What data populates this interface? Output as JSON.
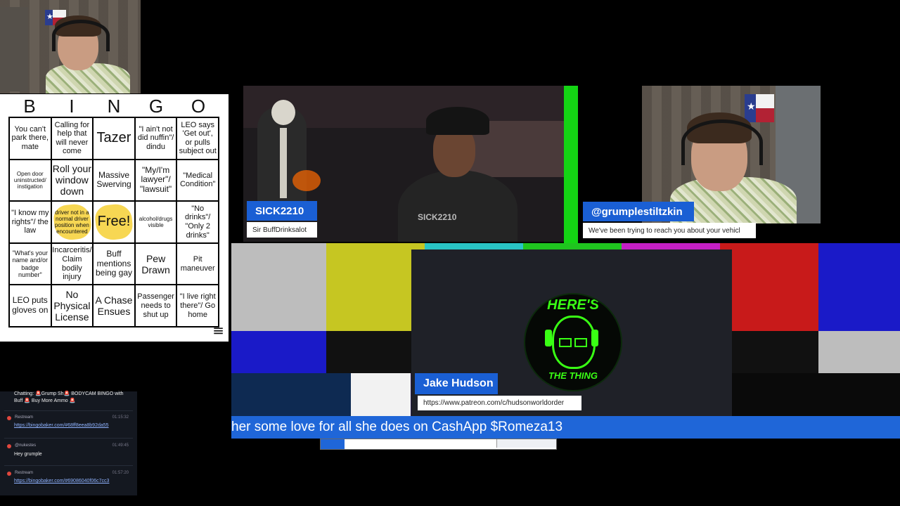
{
  "bingo": {
    "header": [
      "B",
      "I",
      "N",
      "G",
      "O"
    ],
    "cells": [
      {
        "text": "You can't park there, mate",
        "size": "s-s"
      },
      {
        "text": "Calling for help that will never come",
        "size": "s-s"
      },
      {
        "text": "Tazer",
        "size": "s-xl"
      },
      {
        "text": "\"I ain't not did nuffin\"/ dindu",
        "size": "s-s"
      },
      {
        "text": "LEO says 'Get out', or pulls subject out",
        "size": "s-s"
      },
      {
        "text": "Open door uninstructed/ instigation",
        "size": "s-xxs"
      },
      {
        "text": "Roll your window down",
        "size": "s-l"
      },
      {
        "text": "Massive Swerving",
        "size": "s-m"
      },
      {
        "text": "\"My/I'm lawyer\"/ \"lawsuit\"",
        "size": "s-m"
      },
      {
        "text": "\"Medical Condition\"",
        "size": "s-s"
      },
      {
        "text": "\"I know my rights\"/ the law",
        "size": "s-s"
      },
      {
        "text": "driver not in a normal driver position when encountered",
        "size": "s-xxs",
        "marked": true
      },
      {
        "text": "Free!",
        "size": "s-xl",
        "marked": true
      },
      {
        "text": "alcohol/drugs visible",
        "size": "s-xxs"
      },
      {
        "text": "\"No drinks\"/ \"Only 2 drinks\"",
        "size": "s-s"
      },
      {
        "text": "\"What's your name and/or badge number\"",
        "size": "s-xs"
      },
      {
        "text": "Incarceritis/ Claim bodily injury",
        "size": "s-s"
      },
      {
        "text": "Buff mentions being gay",
        "size": "s-m"
      },
      {
        "text": "Pew Drawn",
        "size": "s-l"
      },
      {
        "text": "Pit maneuver",
        "size": "s-s"
      },
      {
        "text": "LEO puts gloves on",
        "size": "s-m"
      },
      {
        "text": "No Physical License",
        "size": "s-l"
      },
      {
        "text": "A Chase Ensues",
        "size": "s-l"
      },
      {
        "text": "Passenger needs to shut up",
        "size": "s-s"
      },
      {
        "text": "\"I live right there\"/ Go home",
        "size": "s-s"
      }
    ],
    "menu_icon": "≡"
  },
  "chat": {
    "top_line": "Chatting: 🚨Grump Sh🚨 BODYCAM BINGO with Buff 🚨 Buy More Ammo 🚨",
    "messages": [
      {
        "user": "Restream",
        "time": "01:15:32",
        "text": "https://bingobaker.com/#68ff8eea8b92da55",
        "is_link": true
      },
      {
        "user": "@nukestes",
        "time": "01:49:45",
        "text": "Hey grumple",
        "is_link": false
      },
      {
        "user": "Restream",
        "time": "01:57:20",
        "text": "https://bingobaker.com/#69086040f06c7cc3",
        "is_link": true
      }
    ]
  },
  "streams": {
    "guest1": {
      "name": "SICK2210",
      "subtitle": "Sir BuffDrinksalot",
      "shirt_text": "SICK2210"
    },
    "guest2": {
      "name": "@grumplestiltzkin",
      "subtitle": "We've been trying to reach you about your vehicl"
    },
    "host": {
      "name": "Jake Hudson",
      "subtitle": "https://www.patreon.com/c/hudsonworldorder",
      "logo_top": "HERE'S",
      "logo_bottom": "THE THING"
    }
  },
  "ticker": {
    "text": "her some love for all she does on CashApp $Romeza13"
  },
  "progress": {
    "fraction": 0.1
  },
  "colors": {
    "accent": "#1f66d8",
    "green_frame": "#14d414",
    "logo_green": "#39ff14",
    "marker": "#f7d54a"
  }
}
